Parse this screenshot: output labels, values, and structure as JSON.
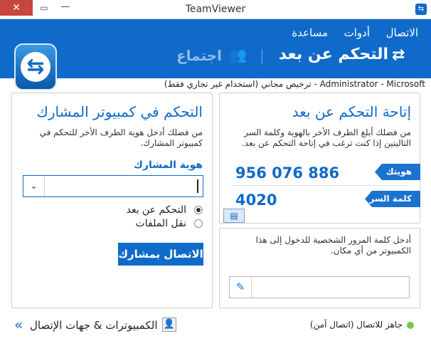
{
  "window": {
    "title": "TeamViewer",
    "close_glyph": "✕",
    "maximize_glyph": "▭",
    "minimize_glyph": "—"
  },
  "menu": {
    "connection": "الاتصال",
    "tools": "أدوات",
    "help": "مساعدة"
  },
  "tabs": {
    "remote_control": "التحكم عن بعد",
    "meeting": "اجتماع"
  },
  "license": "ترخيص مجاني (استخدام غير تجاري فقط) - Administrator - Microsoft",
  "allow_panel": {
    "title": "إتاحة التحكم عن بعد",
    "description": "من فضلك أبلغ الطرف الأخر بالهوية وكلمة السر التاليتين إذا كنت ترغب في إتاحة التحكم عن بعد.",
    "id_label": "هويتك",
    "id_value": "956 076 886",
    "password_label": "كلمة السر",
    "password_value": "4020"
  },
  "personal_panel": {
    "description": "أدخل كلمة المرور الشخصية للدخول إلى هذا الكمبيوتر من أي مكان."
  },
  "control_panel": {
    "title": "التحكم في كمبيوتر المشارك",
    "description": "من فضلك أدخل هوية الطرف الأخر للتحكم في كمبيوتر المشارك.",
    "partner_id_label": "هوية المشارك",
    "partner_id_value": "",
    "options": [
      "التحكم عن بعد",
      "نقل الملفات"
    ],
    "selected_option": 0,
    "connect_button": "الاتصال بمشارك"
  },
  "status": {
    "text": "(جاهز للاتصال (اتصال آمن",
    "color": "#7ac943"
  },
  "footer": {
    "computers_contacts": "الكمبيوترات & جهات الإتصال",
    "expand_glyph": "«"
  },
  "colors": {
    "accent": "#0f6ac9",
    "close": "#c7463f"
  }
}
